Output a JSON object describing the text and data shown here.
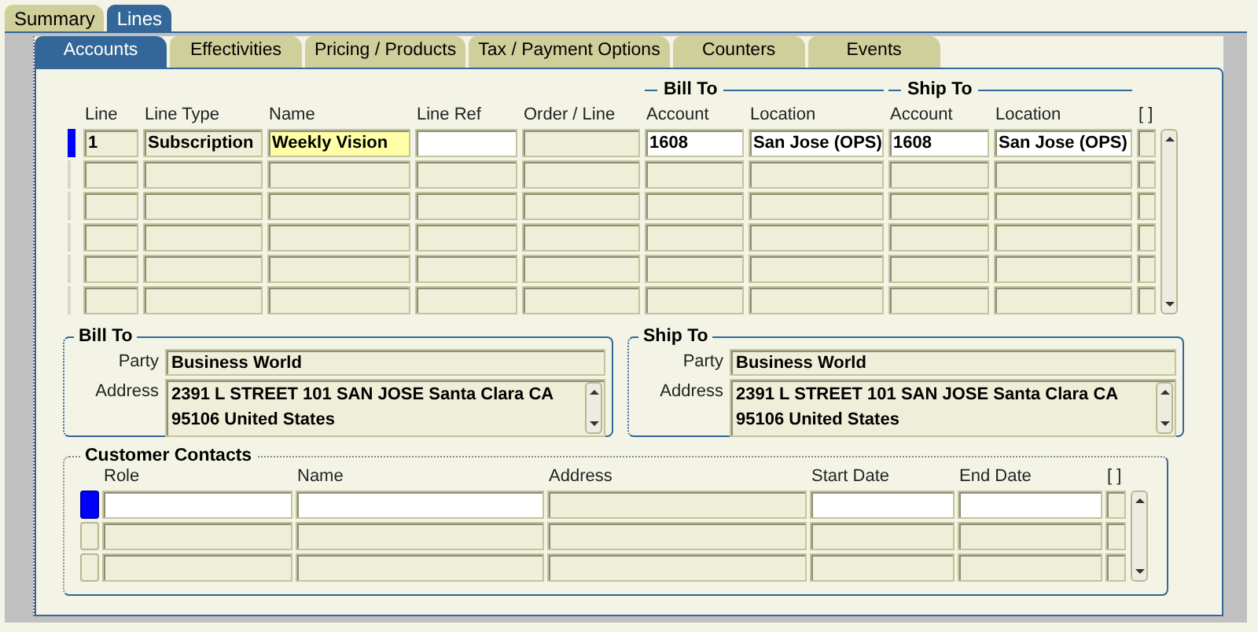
{
  "outer_tabs": [
    {
      "label": "Summary",
      "selected": false
    },
    {
      "label": "Lines",
      "selected": true
    }
  ],
  "inner_tabs": [
    {
      "label": "Accounts",
      "selected": true
    },
    {
      "label": "Effectivities",
      "selected": false
    },
    {
      "label": "Pricing / Products",
      "selected": false
    },
    {
      "label": "Tax / Payment Options",
      "selected": false
    },
    {
      "label": "Counters",
      "selected": false
    },
    {
      "label": "Events",
      "selected": false
    }
  ],
  "lines_table": {
    "columns": [
      {
        "label": "Line"
      },
      {
        "label": "Line Type"
      },
      {
        "label": "Name"
      },
      {
        "label": "Line Ref"
      },
      {
        "label": "Order / Line"
      },
      {
        "label": "Account",
        "group_start": "Bill To"
      },
      {
        "label": "Location",
        "grouped": true
      },
      {
        "label": "Account",
        "group_start": "Ship To"
      },
      {
        "label": "Location",
        "grouped": true
      },
      {
        "label": "[ ]"
      }
    ],
    "rows": [
      {
        "selected": true,
        "cells": [
          {
            "kind": "readonly",
            "value": "1"
          },
          {
            "kind": "readonly",
            "value": "Subscription"
          },
          {
            "kind": "current",
            "value": "Weekly Vision"
          },
          {
            "kind": "editable"
          },
          {
            "kind": "readonly"
          },
          {
            "kind": "editable",
            "value": "1608"
          },
          {
            "kind": "editable",
            "value": "San Jose (OPS)"
          },
          {
            "kind": "editable",
            "value": "1608"
          },
          {
            "kind": "editable",
            "value": "San Jose (OPS)"
          },
          {
            "kind": "readonly"
          }
        ]
      },
      {
        "selected": false,
        "cells": [
          {
            "kind": "readonly"
          },
          {
            "kind": "readonly"
          },
          {
            "kind": "readonly"
          },
          {
            "kind": "readonly"
          },
          {
            "kind": "readonly"
          },
          {
            "kind": "readonly"
          },
          {
            "kind": "readonly"
          },
          {
            "kind": "readonly"
          },
          {
            "kind": "readonly"
          },
          {
            "kind": "readonly"
          }
        ]
      },
      {
        "selected": false,
        "cells": [
          {
            "kind": "readonly"
          },
          {
            "kind": "readonly"
          },
          {
            "kind": "readonly"
          },
          {
            "kind": "readonly"
          },
          {
            "kind": "readonly"
          },
          {
            "kind": "readonly"
          },
          {
            "kind": "readonly"
          },
          {
            "kind": "readonly"
          },
          {
            "kind": "readonly"
          },
          {
            "kind": "readonly"
          }
        ]
      },
      {
        "selected": false,
        "cells": [
          {
            "kind": "readonly"
          },
          {
            "kind": "readonly"
          },
          {
            "kind": "readonly"
          },
          {
            "kind": "readonly"
          },
          {
            "kind": "readonly"
          },
          {
            "kind": "readonly"
          },
          {
            "kind": "readonly"
          },
          {
            "kind": "readonly"
          },
          {
            "kind": "readonly"
          },
          {
            "kind": "readonly"
          }
        ]
      },
      {
        "selected": false,
        "cells": [
          {
            "kind": "readonly"
          },
          {
            "kind": "readonly"
          },
          {
            "kind": "readonly"
          },
          {
            "kind": "readonly"
          },
          {
            "kind": "readonly"
          },
          {
            "kind": "readonly"
          },
          {
            "kind": "readonly"
          },
          {
            "kind": "readonly"
          },
          {
            "kind": "readonly"
          },
          {
            "kind": "readonly"
          }
        ]
      },
      {
        "selected": false,
        "cells": [
          {
            "kind": "readonly"
          },
          {
            "kind": "readonly"
          },
          {
            "kind": "readonly"
          },
          {
            "kind": "readonly"
          },
          {
            "kind": "readonly"
          },
          {
            "kind": "readonly"
          },
          {
            "kind": "readonly"
          },
          {
            "kind": "readonly"
          },
          {
            "kind": "readonly"
          },
          {
            "kind": "readonly"
          }
        ]
      }
    ]
  },
  "parties": [
    {
      "title": "Bill To",
      "party_label": "Party",
      "party": "Business World",
      "address_label": "Address",
      "address": "2391 L STREET 101 SAN JOSE Santa Clara CA\n95106 United States"
    },
    {
      "title": "Ship To",
      "party_label": "Party",
      "party": "Business World",
      "address_label": "Address",
      "address": "2391 L STREET 101 SAN JOSE Santa Clara CA\n95106 United States"
    }
  ],
  "customer_contacts": {
    "title": "Customer Contacts",
    "columns": [
      {
        "label": "Role"
      },
      {
        "label": "Name"
      },
      {
        "label": "Address"
      },
      {
        "label": "Start Date"
      },
      {
        "label": "End Date"
      },
      {
        "label": "[ ]"
      }
    ],
    "rows": [
      {
        "selected": true,
        "cells": [
          {
            "kind": "editable"
          },
          {
            "kind": "editable"
          },
          {
            "kind": "readonly"
          },
          {
            "kind": "editable"
          },
          {
            "kind": "editable"
          },
          {
            "kind": "readonly"
          }
        ]
      },
      {
        "selected": false,
        "cells": [
          {
            "kind": "readonly"
          },
          {
            "kind": "readonly"
          },
          {
            "kind": "readonly"
          },
          {
            "kind": "readonly"
          },
          {
            "kind": "readonly"
          },
          {
            "kind": "readonly"
          }
        ]
      },
      {
        "selected": false,
        "cells": [
          {
            "kind": "readonly"
          },
          {
            "kind": "readonly"
          },
          {
            "kind": "readonly"
          },
          {
            "kind": "readonly"
          },
          {
            "kind": "readonly"
          },
          {
            "kind": "readonly"
          }
        ]
      }
    ]
  }
}
